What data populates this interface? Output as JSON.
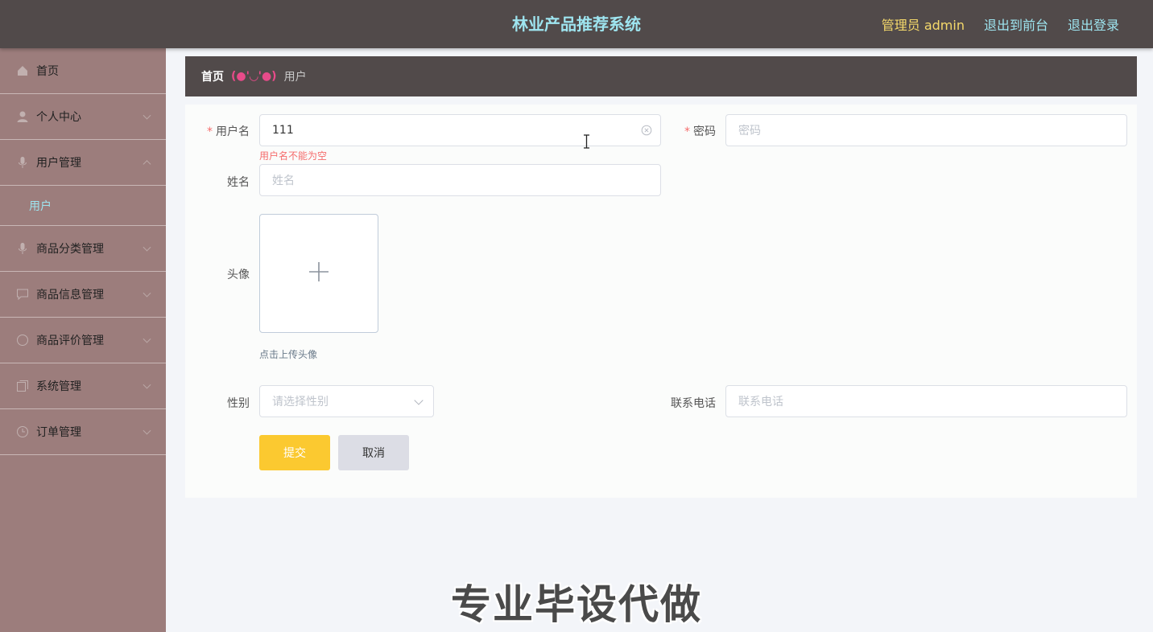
{
  "header": {
    "title": "林业产品推荐系统",
    "admin_label": "管理员 admin",
    "to_front": "退出到前台",
    "logout": "退出登录"
  },
  "sidebar": {
    "items": [
      {
        "label": "首页",
        "icon": "home-icon"
      },
      {
        "label": "个人中心",
        "icon": "user-icon"
      },
      {
        "label": "用户管理",
        "icon": "mic-icon",
        "expanded": true,
        "children": [
          "用户"
        ]
      },
      {
        "label": "商品分类管理",
        "icon": "mic-icon"
      },
      {
        "label": "商品信息管理",
        "icon": "chat-icon"
      },
      {
        "label": "商品评价管理",
        "icon": "circle-icon"
      },
      {
        "label": "系统管理",
        "icon": "copy-icon"
      },
      {
        "label": "订单管理",
        "icon": "clock-icon"
      }
    ]
  },
  "breadcrumb": {
    "home": "首页",
    "separator": "(●'◡'●)",
    "current": "用户"
  },
  "form": {
    "username": {
      "label": "用户名",
      "value": "111",
      "error": "用户名不能为空"
    },
    "password": {
      "label": "密码",
      "placeholder": "密码"
    },
    "name": {
      "label": "姓名",
      "placeholder": "姓名"
    },
    "avatar": {
      "label": "头像",
      "hint": "点击上传头像"
    },
    "gender": {
      "label": "性别",
      "placeholder": "请选择性别"
    },
    "phone": {
      "label": "联系电话",
      "placeholder": "联系电话"
    },
    "submit": "提交",
    "cancel": "取消"
  },
  "watermark": "专业毕设代做",
  "colors": {
    "header_bg": "#514a4a",
    "sidebar_bg": "#9c7d7c",
    "accent_cyan": "#9ee5f0",
    "submit_yellow": "#fbc930",
    "error_red": "#f56c6c"
  }
}
